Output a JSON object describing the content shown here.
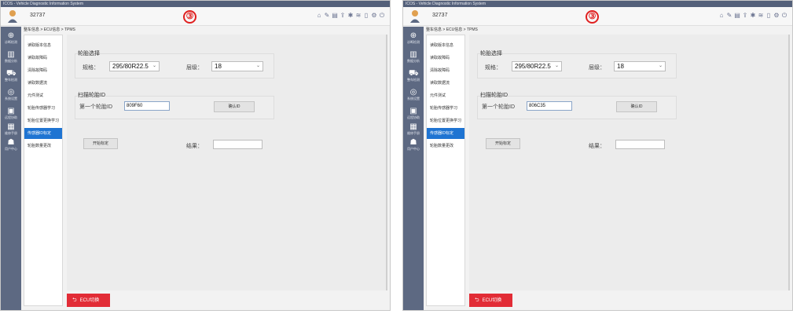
{
  "window_title": "ICOS - Vehicle Diagnostic Information System",
  "user": {
    "id": "32737"
  },
  "step_marker": "③",
  "top_icons": [
    "home-icon",
    "wrench-icon",
    "book-icon",
    "upload-icon",
    "bluetooth-icon",
    "wifi-icon",
    "document-icon",
    "settings-icon",
    "power-icon"
  ],
  "breadcrumb": "整车信息 > ECU信息 > TPMS",
  "sidebar": {
    "items": [
      {
        "label": "诊断检测",
        "icon": "diagnosis-icon"
      },
      {
        "label": "数据分析",
        "icon": "analysis-icon"
      },
      {
        "label": "整车检测",
        "icon": "vehicle-icon"
      },
      {
        "label": "系统设置",
        "icon": "system-icon"
      },
      {
        "label": "远程协助",
        "icon": "remote-icon"
      },
      {
        "label": "维修手册",
        "icon": "manual-icon"
      },
      {
        "label": "用户中心",
        "icon": "user-center-icon"
      }
    ]
  },
  "menu": {
    "items": [
      {
        "label": "读取版本信息",
        "active": false
      },
      {
        "label": "读取故障码",
        "active": false
      },
      {
        "label": "清除故障码",
        "active": false
      },
      {
        "label": "读取数据流",
        "active": false
      },
      {
        "label": "元件测试",
        "active": false
      },
      {
        "label": "轮胎传感器学习",
        "active": false
      },
      {
        "label": "轮胎位置更换学习",
        "active": false
      },
      {
        "label": "传感器ID标定",
        "active": true
      },
      {
        "label": "轮胎数量更改",
        "active": false
      }
    ]
  },
  "tire_select": {
    "title": "轮胎选择",
    "spec_label": "规格：",
    "spec_value": "295/80R22.5",
    "layers_label": "层级：",
    "layers_value": "18"
  },
  "scan": {
    "title": "扫描轮胎ID",
    "first_tire_label": "第一个轮胎ID",
    "confirm_label": "确认ID"
  },
  "calibration": {
    "start_label": "开始标定",
    "result_label": "结果："
  },
  "footer": {
    "ecu_switch_label": "ECU切换"
  },
  "screens": [
    {
      "first_tire_id": "809F60"
    },
    {
      "first_tire_id": "806C35"
    }
  ],
  "colors": {
    "sidebar": "#5d6982",
    "accent": "#1f74d2",
    "danger": "#e22c36",
    "step_marker": "#e02020"
  }
}
